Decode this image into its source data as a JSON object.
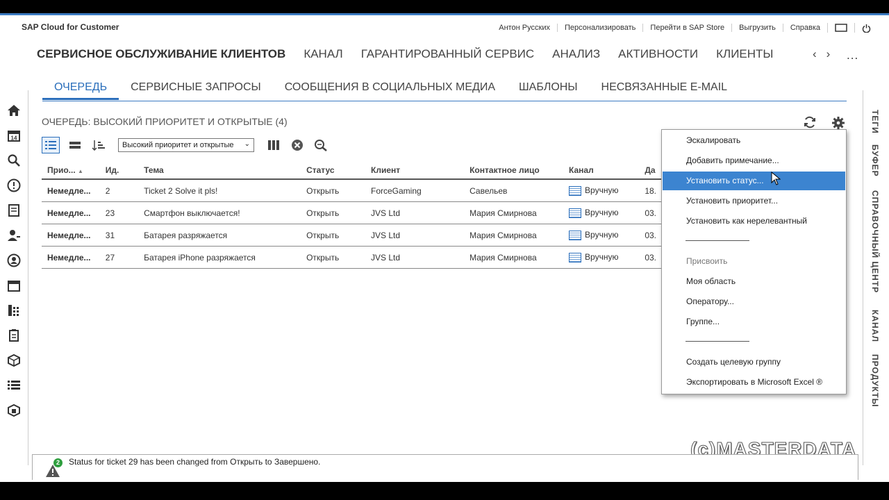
{
  "app": {
    "brand": "SAP Cloud for Customer"
  },
  "header": {
    "links": [
      "Антон Русских",
      "Персонализировать",
      "Перейти в SAP Store",
      "Выгрузить",
      "Справка"
    ]
  },
  "main_nav": {
    "items": [
      "СЕРВИСНОЕ ОБСЛУЖИВАНИЕ КЛИЕНТОВ",
      "КАНАЛ",
      "ГАРАНТИРОВАННЫЙ СЕРВИС",
      "АНАЛИЗ",
      "АКТИВНОСТИ",
      "КЛИЕНТЫ"
    ],
    "prev": "‹",
    "next": "›",
    "more": "..."
  },
  "left_rail": {
    "icons": [
      "home-icon",
      "calendar-icon",
      "search-icon",
      "alert-icon",
      "document-icon",
      "contacts-icon",
      "person-icon",
      "schedule-icon",
      "grid-icon",
      "checklist-icon",
      "box-icon",
      "list-icon",
      "product-icon"
    ],
    "calendar_day": "14"
  },
  "right_rail": {
    "items": [
      "ТЕГИ",
      "БУФЕР",
      "СПРАВОЧНЫЙ ЦЕНТР",
      "КАНАЛ",
      "ПРОДУКТЫ"
    ]
  },
  "sub_tabs": {
    "active_index": 0,
    "items": [
      "ОЧЕРЕДЬ",
      "СЕРВИСНЫЕ ЗАПРОСЫ",
      "СООБЩЕНИЯ В СОЦИАЛЬНЫХ МЕДИА",
      "ШАБЛОНЫ",
      "НЕСВЯЗАННЫЕ E-MAIL"
    ]
  },
  "queue": {
    "title": "ОЧЕРЕДЬ: ВЫСОКИЙ ПРИОРИТЕТ И ОТКРЫТЫЕ (4)",
    "filter_value": "Высокий приоритет и открытые",
    "columns": [
      "Прио...",
      "Ид.",
      "Тема",
      "Статус",
      "Клиент",
      "Контактное лицо",
      "Канал",
      "Да"
    ],
    "sort_indicator": "▲",
    "rows": [
      {
        "priority": "Немедле...",
        "id": "2",
        "subject": "Ticket 2 Solve it pls!",
        "status": "Открыть",
        "client": "ForceGaming",
        "contact": "Савельев",
        "channel": "Вручную",
        "date": "18."
      },
      {
        "priority": "Немедле...",
        "id": "23",
        "subject": "Смартфон выключается!",
        "status": "Открыть",
        "client": "JVS Ltd",
        "contact": "Мария Смирнова",
        "channel": "Вручную",
        "date": "03."
      },
      {
        "priority": "Немедле...",
        "id": "31",
        "subject": "Батарея разряжается",
        "status": "Открыть",
        "client": "JVS Ltd",
        "contact": "Мария Смирнова",
        "channel": "Вручную",
        "date": "03."
      },
      {
        "priority": "Немедле...",
        "id": "27",
        "subject": "Батарея iPhone разряжается",
        "status": "Открыть",
        "client": "JVS Ltd",
        "contact": "Мария Смирнова",
        "channel": "Вручную",
        "date": "03."
      }
    ]
  },
  "context_menu": {
    "highlighted": "Установить статус...",
    "items": [
      "Эскалировать",
      "Добавить примечание...",
      "Установить статус...",
      "Установить приоритет...",
      "Установить как нерелевантный"
    ],
    "assign_header": "Присвоить",
    "assign_items": [
      "Моя область",
      "Оператору...",
      "Группе..."
    ],
    "extra_items": [
      "Создать целевую группу",
      "Экспортировать в Microsoft Excel ®"
    ]
  },
  "notification": {
    "count": "2",
    "message": "Status for ticket 29 has been changed from Открыть to Завершено."
  },
  "watermark": "(c)MASTERDATA",
  "colors": {
    "accent": "#2a6ebb",
    "priority": "#b02020",
    "highlight": "#3c84d0"
  }
}
